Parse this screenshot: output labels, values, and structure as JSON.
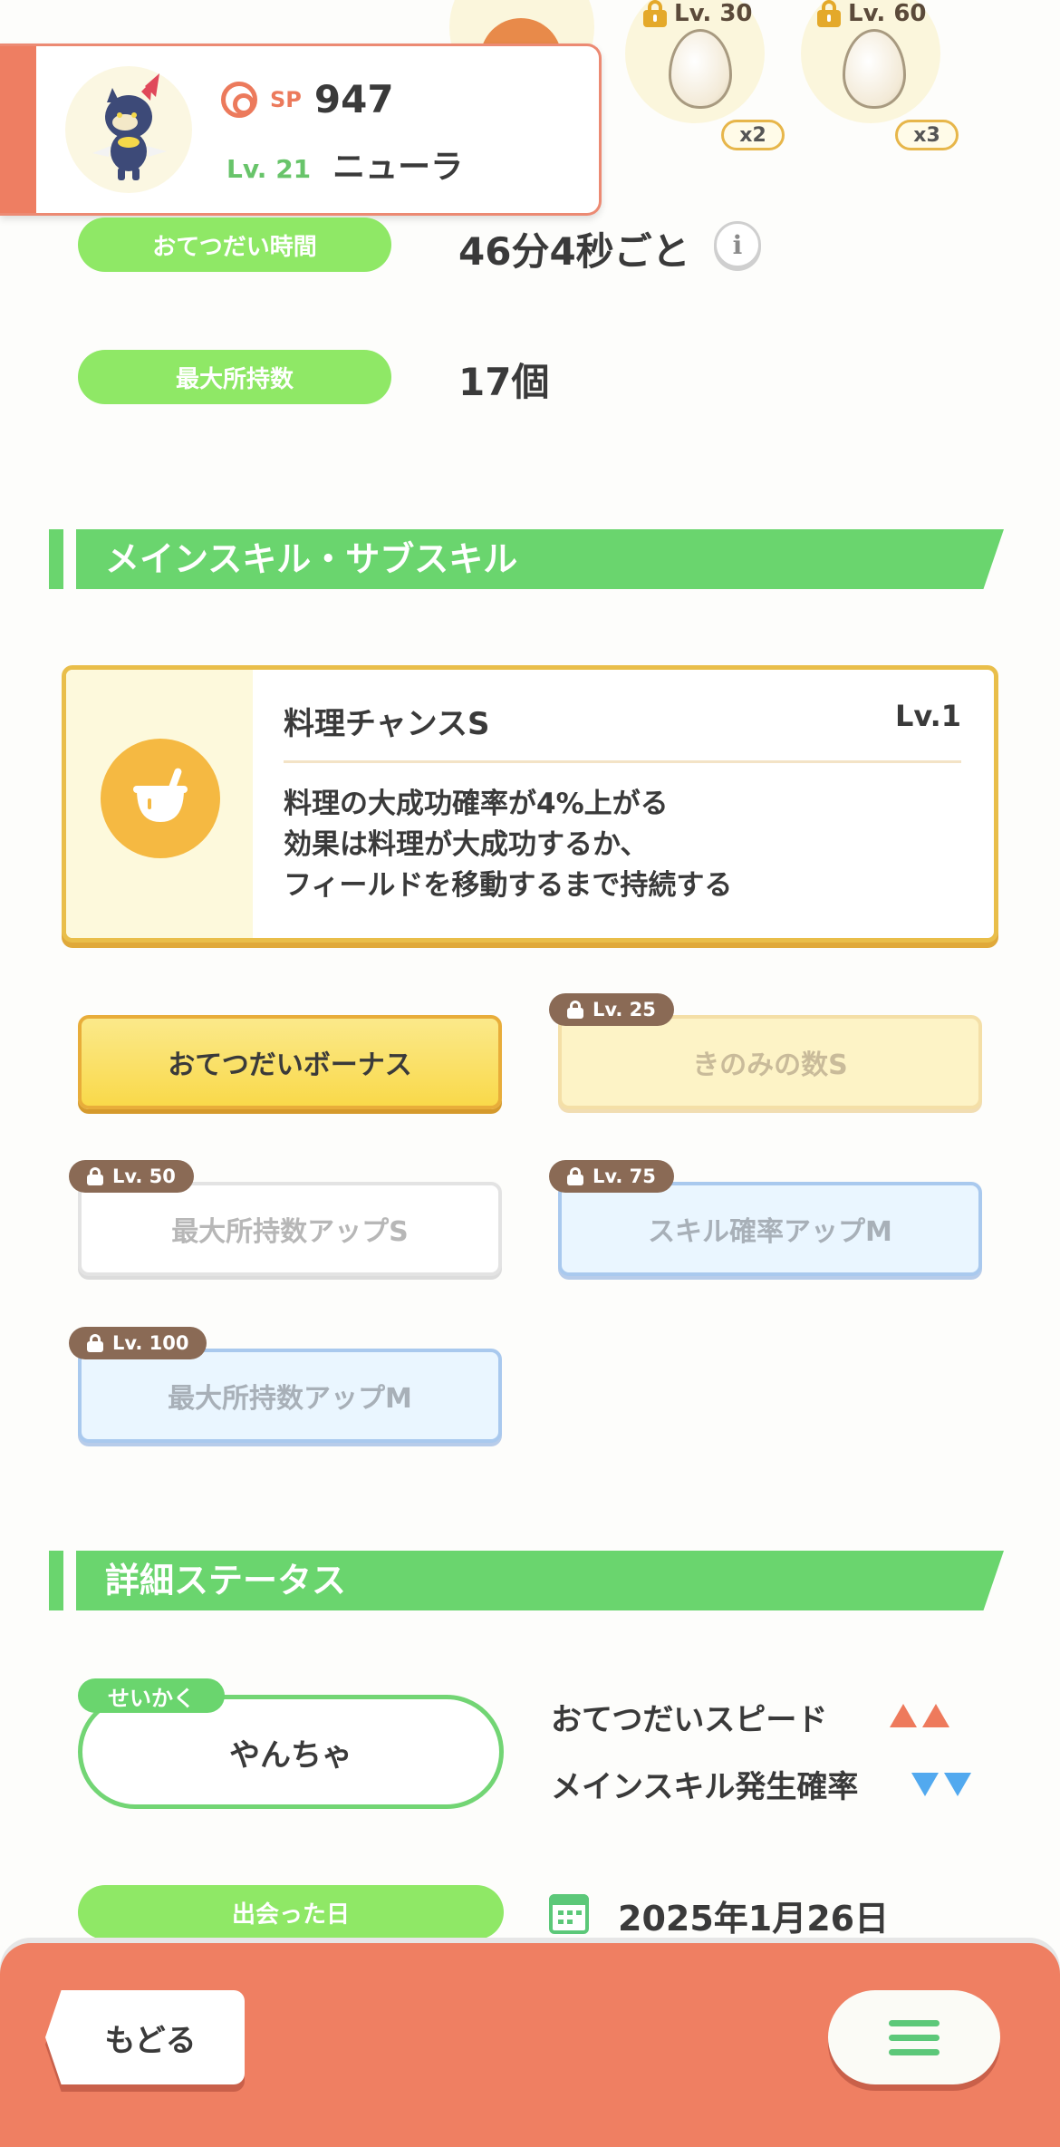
{
  "ingredients": [
    {
      "lock_level": "Lv. 30",
      "multiplier": "x2"
    },
    {
      "lock_level": "Lv. 60",
      "multiplier": "x3"
    }
  ],
  "pokemon": {
    "sp_label": "SP",
    "sp_value": "947",
    "level": "Lv. 21",
    "name": "ニューラ"
  },
  "info": {
    "help_time_label": "おてつだい時間",
    "help_time_value": "46分4秒ごと",
    "info_symbol": "i",
    "max_carry_label": "最大所持数",
    "max_carry_value": "17個"
  },
  "skills_section": {
    "title": "メインスキル・サブスキル",
    "main_skill": {
      "name": "料理チャンスS",
      "level": "Lv.1",
      "desc_line1": "料理の大成功確率が4%上がる",
      "desc_line2": "効果は料理が大成功するか、",
      "desc_line3": "フィールドを移動するまで持続する"
    },
    "sub_skills": [
      {
        "label": "おてつだいボーナス",
        "lock": ""
      },
      {
        "label": "きのみの数S",
        "lock": "Lv. 25"
      },
      {
        "label": "最大所持数アップS",
        "lock": "Lv. 50"
      },
      {
        "label": "スキル確率アップM",
        "lock": "Lv. 75"
      },
      {
        "label": "最大所持数アップM",
        "lock": "Lv. 100"
      }
    ]
  },
  "details_section": {
    "title": "詳細ステータス",
    "nature_tag": "せいかく",
    "nature": "やんちゃ",
    "trait_up": "おてつだいスピード",
    "trait_down": "メインスキル発生確率",
    "met_label": "出会った日",
    "met_date": "2025年1月26日"
  },
  "footer": {
    "back_label": "もどる"
  },
  "colors": {
    "accent_orange": "#ef7f62",
    "green": "#6ad56e",
    "gold": "#e9be4a"
  }
}
